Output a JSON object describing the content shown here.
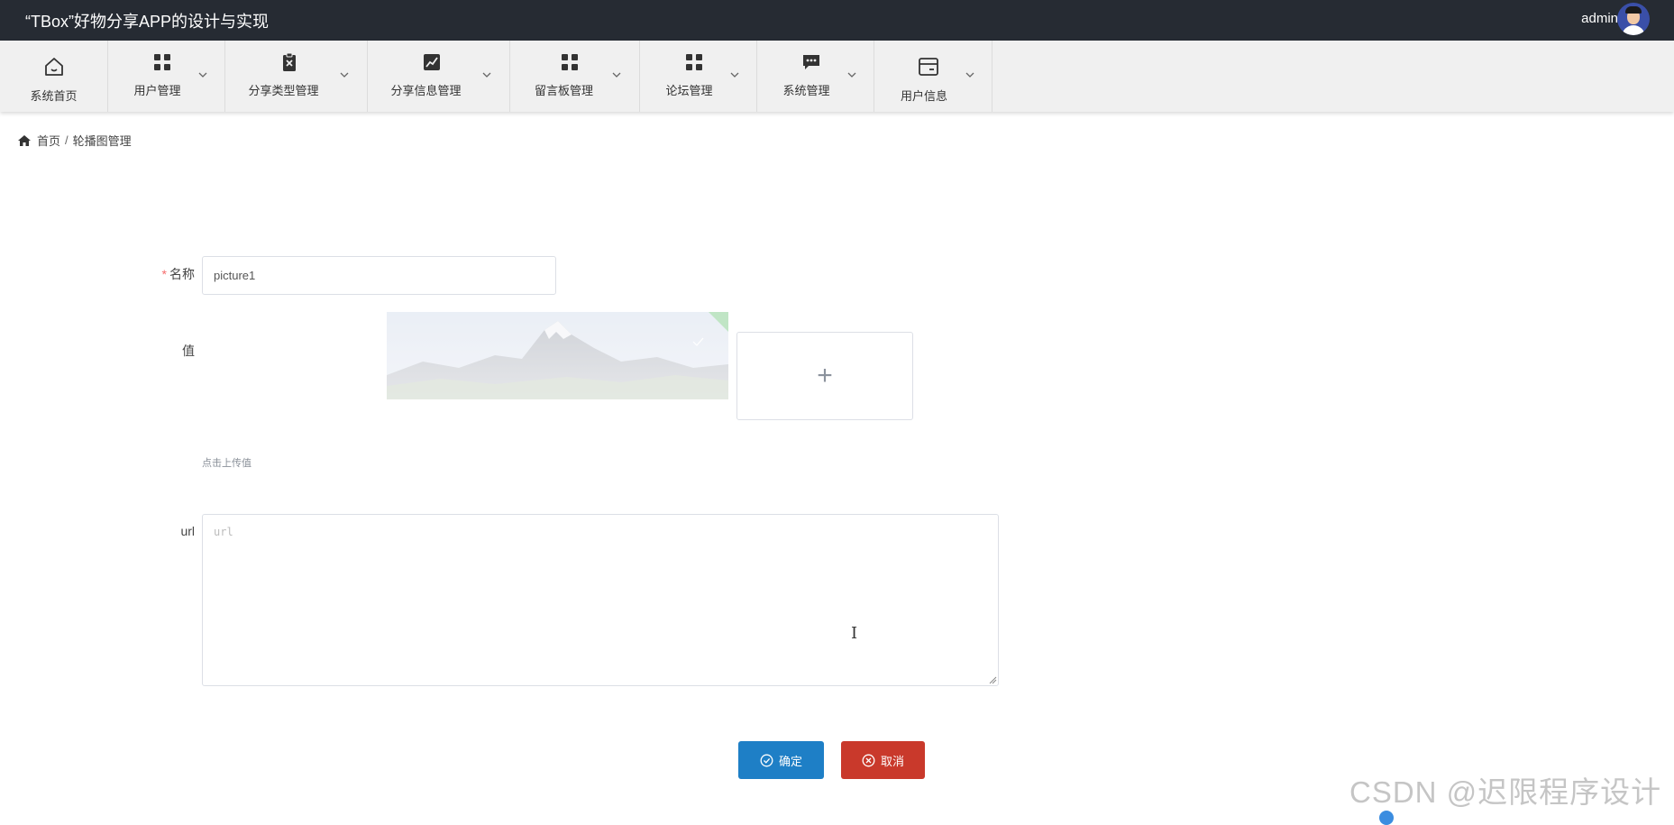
{
  "header": {
    "title": "“TBox”好物分享APP的设计与实现",
    "username": "admin"
  },
  "nav": {
    "items": [
      {
        "label": "系统首页",
        "icon": "home-icon",
        "has_dropdown": false
      },
      {
        "label": "用户管理",
        "icon": "grid-icon",
        "has_dropdown": true
      },
      {
        "label": "分享类型管理",
        "icon": "clipboard-x-icon",
        "has_dropdown": true
      },
      {
        "label": "分享信息管理",
        "icon": "line-chart-icon",
        "has_dropdown": true
      },
      {
        "label": "留言板管理",
        "icon": "grid-icon",
        "has_dropdown": true
      },
      {
        "label": "论坛管理",
        "icon": "grid-icon",
        "has_dropdown": true
      },
      {
        "label": "系统管理",
        "icon": "chat-bubble-icon",
        "has_dropdown": true
      },
      {
        "label": "用户信息",
        "icon": "card-icon",
        "has_dropdown": true
      }
    ]
  },
  "breadcrumb": {
    "home": "首页",
    "separator": "/",
    "current": "轮播图管理"
  },
  "form": {
    "name_label": "名称",
    "required_mark": "*",
    "name_value": "picture1",
    "value_label": "值",
    "upload_hint": "点击上传值",
    "upload_plus": "+",
    "url_label": "url",
    "url_placeholder": "url"
  },
  "buttons": {
    "confirm": "确定",
    "cancel": "取消"
  },
  "watermark": "CSDN @迟限程序设计",
  "colors": {
    "topbar": "#262b33",
    "nav_bg": "#f0f0f0",
    "confirm": "#1e7fc6",
    "cancel": "#c9392b",
    "required": "#f56c6c"
  }
}
